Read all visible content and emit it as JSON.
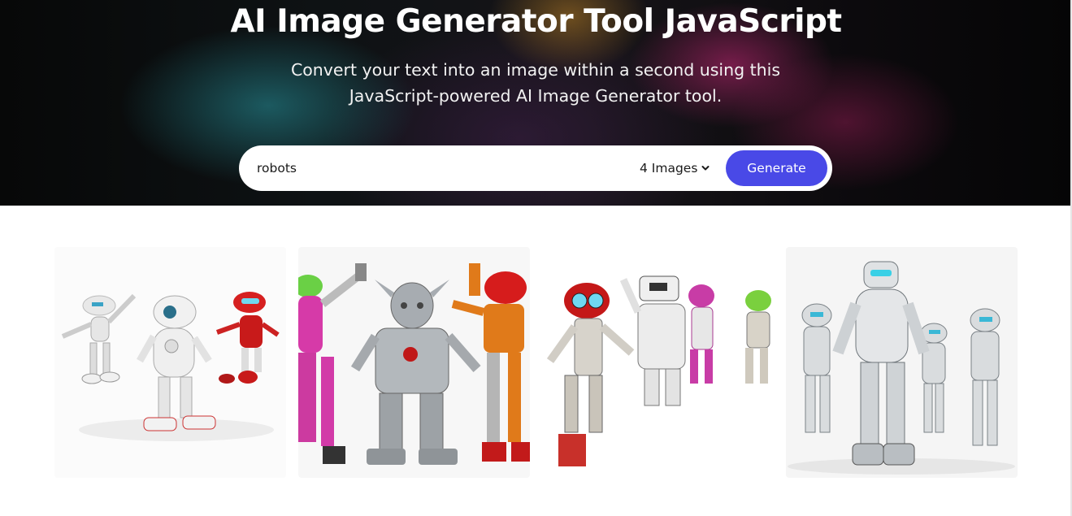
{
  "hero": {
    "title": "AI Image Generator Tool JavaScript",
    "subtitle_line1": "Convert your text into an image within a second using this",
    "subtitle_line2": "JavaScript-powered AI Image Generator tool."
  },
  "form": {
    "prompt_value": "robots",
    "image_count": "4 Images",
    "generate_label": "Generate",
    "dropdown_icon": "chevron-down-icon"
  },
  "gallery": {
    "images": [
      {
        "subject": "robots"
      },
      {
        "subject": "robots"
      },
      {
        "subject": "robots"
      },
      {
        "subject": "robots"
      }
    ]
  },
  "colors": {
    "accent": "#4949e7",
    "hero_bg": "#0b0c0e"
  }
}
